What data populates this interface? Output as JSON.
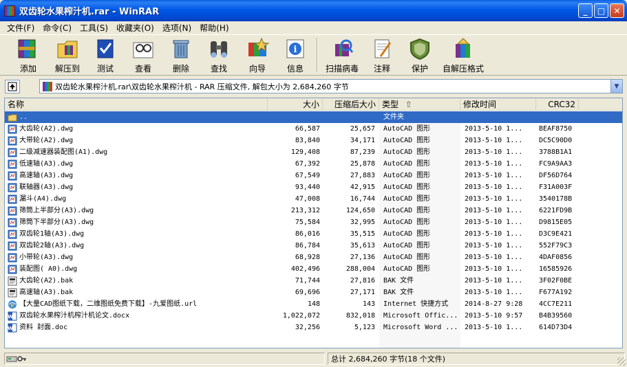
{
  "window": {
    "title": "双齿轮水果榨汁机.rar - WinRAR",
    "buttons": [
      "minimize",
      "maximize",
      "close"
    ]
  },
  "menu": [
    "文件(F)",
    "命令(C)",
    "工具(S)",
    "收藏夹(O)",
    "选项(N)",
    "帮助(H)"
  ],
  "toolbar": [
    {
      "label": "添加",
      "icon": "add-archive-icon"
    },
    {
      "label": "解压到",
      "icon": "extract-to-icon"
    },
    {
      "label": "测试",
      "icon": "test-icon"
    },
    {
      "label": "查看",
      "icon": "view-icon"
    },
    {
      "label": "删除",
      "icon": "delete-icon"
    },
    {
      "label": "查找",
      "icon": "find-binoculars-icon"
    },
    {
      "label": "向导",
      "icon": "wizard-icon"
    },
    {
      "label": "信息",
      "icon": "info-icon"
    },
    {
      "label": "扫描病毒",
      "icon": "virus-scan-icon"
    },
    {
      "label": "注释",
      "icon": "comment-icon"
    },
    {
      "label": "保护",
      "icon": "protect-shield-icon"
    },
    {
      "label": "自解压格式",
      "icon": "sfx-icon"
    }
  ],
  "address": {
    "text": "双齿轮水果榨汁机.rar\\双齿轮水果榨汁机 - RAR 压缩文件, 解包大小为 2,684,260 字节"
  },
  "columns": {
    "name": "名称",
    "size": "大小",
    "packed": "压缩后大小",
    "type": "类型",
    "modified": "修改时间",
    "crc": "CRC32"
  },
  "files": [
    {
      "name": "..",
      "size": "",
      "packed": "",
      "type": "文件夹",
      "modified": "",
      "crc": "",
      "icon": "folder-icon",
      "selected": true
    },
    {
      "name": "大齿轮(A2).dwg",
      "size": "66,587",
      "packed": "25,657",
      "type": "AutoCAD 图形",
      "modified": "2013-5-10 1...",
      "crc": "BEAF8750",
      "icon": "dwg-file-icon"
    },
    {
      "name": "大带轮(A2).dwg",
      "size": "83,840",
      "packed": "34,171",
      "type": "AutoCAD 图形",
      "modified": "2013-5-10 1...",
      "crc": "DC5C90D0",
      "icon": "dwg-file-icon"
    },
    {
      "name": "二级减速器装配图(A1).dwg",
      "size": "129,408",
      "packed": "87,239",
      "type": "AutoCAD 图形",
      "modified": "2013-5-10 1...",
      "crc": "3788B1A1",
      "icon": "dwg-file-icon"
    },
    {
      "name": "低速轴(A3).dwg",
      "size": "67,392",
      "packed": "25,878",
      "type": "AutoCAD 图形",
      "modified": "2013-5-10 1...",
      "crc": "FC9A9AA3",
      "icon": "dwg-file-icon"
    },
    {
      "name": "高速轴(A3).dwg",
      "size": "67,549",
      "packed": "27,883",
      "type": "AutoCAD 图形",
      "modified": "2013-5-10 1...",
      "crc": "DF56D764",
      "icon": "dwg-file-icon"
    },
    {
      "name": "联轴器(A3).dwg",
      "size": "93,440",
      "packed": "42,915",
      "type": "AutoCAD 图形",
      "modified": "2013-5-10 1...",
      "crc": "F31A003F",
      "icon": "dwg-file-icon"
    },
    {
      "name": "漏斗(A4).dwg",
      "size": "47,008",
      "packed": "16,744",
      "type": "AutoCAD 图形",
      "modified": "2013-5-10 1...",
      "crc": "3540178B",
      "icon": "dwg-file-icon"
    },
    {
      "name": "筛筒上半部分(A3).dwg",
      "size": "213,312",
      "packed": "124,650",
      "type": "AutoCAD 图形",
      "modified": "2013-5-10 1...",
      "crc": "6221FD9B",
      "icon": "dwg-file-icon"
    },
    {
      "name": "筛筒下半部分(A3).dwg",
      "size": "75,584",
      "packed": "32,995",
      "type": "AutoCAD 图形",
      "modified": "2013-5-10 1...",
      "crc": "D9815E05",
      "icon": "dwg-file-icon"
    },
    {
      "name": "双齿轮1轴(A3).dwg",
      "size": "86,016",
      "packed": "35,515",
      "type": "AutoCAD 图形",
      "modified": "2013-5-10 1...",
      "crc": "D3C9E421",
      "icon": "dwg-file-icon"
    },
    {
      "name": "双齿轮2轴(A3).dwg",
      "size": "86,784",
      "packed": "35,613",
      "type": "AutoCAD 图形",
      "modified": "2013-5-10 1...",
      "crc": "552F79C3",
      "icon": "dwg-file-icon"
    },
    {
      "name": "小带轮(A3).dwg",
      "size": "68,928",
      "packed": "27,136",
      "type": "AutoCAD 图形",
      "modified": "2013-5-10 1...",
      "crc": "4DAF0856",
      "icon": "dwg-file-icon"
    },
    {
      "name": "装配图( A0).dwg",
      "size": "402,496",
      "packed": "288,004",
      "type": "AutoCAD 图形",
      "modified": "2013-5-10 1...",
      "crc": "16585926",
      "icon": "dwg-file-icon"
    },
    {
      "name": "大齿轮(A2).bak",
      "size": "71,744",
      "packed": "27,816",
      "type": "BAK 文件",
      "modified": "2013-5-10 1...",
      "crc": "3F02F0BE",
      "icon": "bak-file-icon"
    },
    {
      "name": "高速轴(A3).bak",
      "size": "69,696",
      "packed": "27,171",
      "type": "BAK 文件",
      "modified": "2013-5-10 1...",
      "crc": "F677A192",
      "icon": "bak-file-icon"
    },
    {
      "name": "【大量CAD图纸下载，二维图纸免费下载】-九爱图纸.url",
      "size": "148",
      "packed": "143",
      "type": "Internet 快捷方式",
      "modified": "2014-8-27 9:28",
      "crc": "4CC7E211",
      "icon": "url-file-icon"
    },
    {
      "name": "双齿轮水果榨汁机榨汁机论文.docx",
      "size": "1,022,072",
      "packed": "832,018",
      "type": "Microsoft Offic...",
      "modified": "2013-5-10 9:57",
      "crc": "B4B39560",
      "icon": "word-file-icon"
    },
    {
      "name": "资料 封面.doc",
      "size": "32,256",
      "packed": "5,123",
      "type": "Microsoft Word ...",
      "modified": "2013-5-10 1...",
      "crc": "614D73D4",
      "icon": "word-file-icon"
    }
  ],
  "status": {
    "right": "总计 2,684,260 字节(18 个文件)"
  },
  "colors": {
    "titlebar": "#0058E6",
    "selection": "#316AC5",
    "chrome": "#ECE9D8"
  }
}
